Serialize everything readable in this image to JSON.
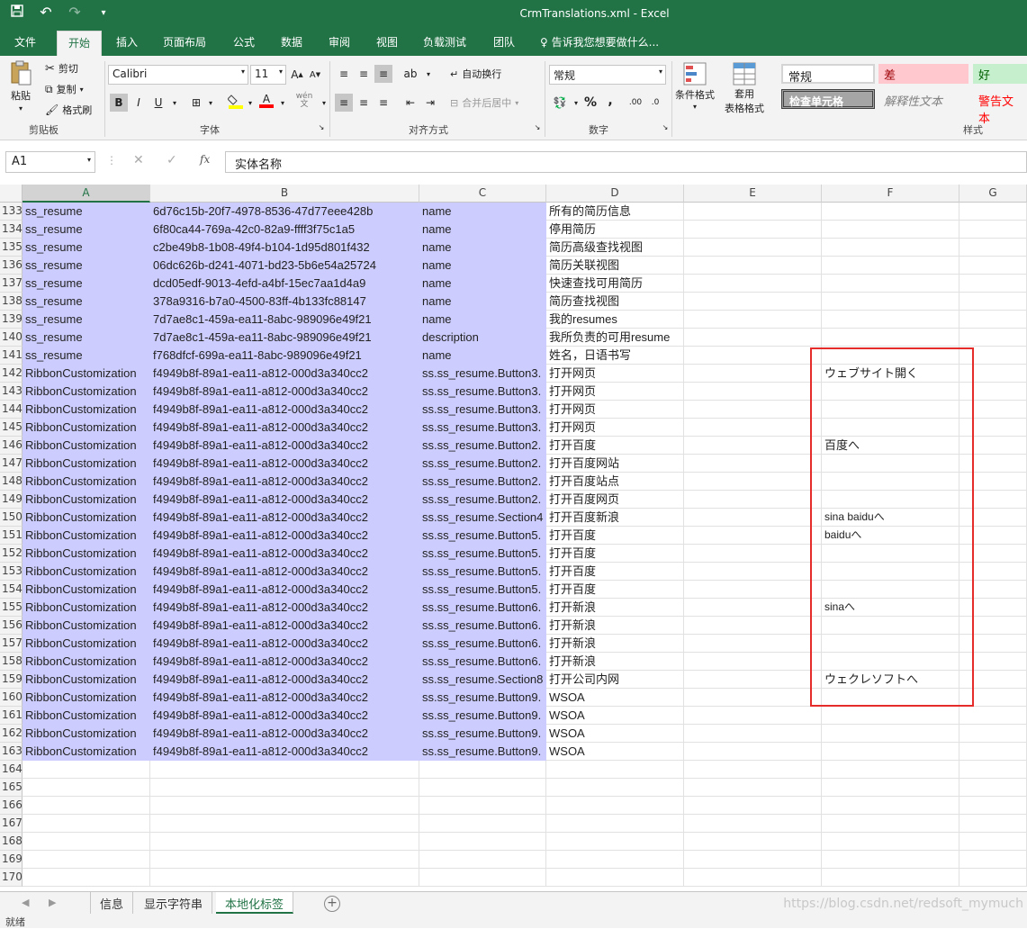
{
  "window": {
    "title": "CrmTranslations.xml - Excel"
  },
  "qat": {
    "save_icon": "save-icon",
    "undo_icon": "undo-icon",
    "redo_icon": "redo-icon"
  },
  "ribbon_tabs": [
    "文件",
    "开始",
    "插入",
    "页面布局",
    "公式",
    "数据",
    "审阅",
    "视图",
    "负载测试",
    "团队"
  ],
  "tell_me": "告诉我您想要做什么...",
  "clipboard": {
    "paste": "粘贴",
    "cut": "剪切",
    "copy": "复制",
    "format_painter": "格式刷",
    "label": "剪贴板"
  },
  "font": {
    "name": "Calibri",
    "size": "11",
    "bold": "B",
    "italic": "I",
    "underline": "U",
    "label": "字体",
    "wen": "wén",
    "wen_char": "文"
  },
  "alignment": {
    "wrap_text": "自动换行",
    "merge_center": "合并后居中",
    "label": "对齐方式"
  },
  "number": {
    "format": "常规",
    "percent": "%",
    "comma": ",",
    "label": "数字"
  },
  "styles": {
    "conditional_formatting": "条件格式",
    "format_as_table_1": "套用",
    "format_as_table_2": "表格格式",
    "normal": "常规",
    "bad": "差",
    "good": "好",
    "check_cell": "检查单元格",
    "explanatory": "解释性文本",
    "warning": "警告文本",
    "label": "样式"
  },
  "formula_bar": {
    "name_box": "A1",
    "content": "实体名称"
  },
  "columns": [
    "A",
    "B",
    "C",
    "D",
    "E",
    "F",
    "G"
  ],
  "rows": [
    {
      "n": "133",
      "a": "ss_resume",
      "b": "6d76c15b-20f7-4978-8536-47d77eee428b",
      "c": "name",
      "d": "所有的简历信息",
      "f": ""
    },
    {
      "n": "134",
      "a": "ss_resume",
      "b": "6f80ca44-769a-42c0-82a9-ffff3f75c1a5",
      "c": "name",
      "d": "停用简历",
      "f": ""
    },
    {
      "n": "135",
      "a": "ss_resume",
      "b": "c2be49b8-1b08-49f4-b104-1d95d801f432",
      "c": "name",
      "d": "简历高级查找视图",
      "f": ""
    },
    {
      "n": "136",
      "a": "ss_resume",
      "b": "06dc626b-d241-4071-bd23-5b6e54a25724",
      "c": "name",
      "d": "简历关联视图",
      "f": ""
    },
    {
      "n": "137",
      "a": "ss_resume",
      "b": "dcd05edf-9013-4efd-a4bf-15ec7aa1d4a9",
      "c": "name",
      "d": "快速查找可用简历",
      "f": ""
    },
    {
      "n": "138",
      "a": "ss_resume",
      "b": "378a9316-b7a0-4500-83ff-4b133fc88147",
      "c": "name",
      "d": "简历查找视图",
      "f": ""
    },
    {
      "n": "139",
      "a": "ss_resume",
      "b": "7d7ae8c1-459a-ea11-8abc-989096e49f21",
      "c": "name",
      "d": "我的resumes",
      "f": ""
    },
    {
      "n": "140",
      "a": "ss_resume",
      "b": "7d7ae8c1-459a-ea11-8abc-989096e49f21",
      "c": "description",
      "d": "我所负责的可用resume",
      "f": ""
    },
    {
      "n": "141",
      "a": "ss_resume",
      "b": "f768dfcf-699a-ea11-8abc-989096e49f21",
      "c": "name",
      "d": "姓名，日语书写",
      "f": ""
    },
    {
      "n": "142",
      "a": "RibbonCustomization",
      "b": "f4949b8f-89a1-ea11-a812-000d3a340cc2",
      "c": "ss.ss_resume.Button3.",
      "d": "打开网页",
      "f": "ウェブサイト開く"
    },
    {
      "n": "143",
      "a": "RibbonCustomization",
      "b": "f4949b8f-89a1-ea11-a812-000d3a340cc2",
      "c": "ss.ss_resume.Button3.",
      "d": "打开网页",
      "f": ""
    },
    {
      "n": "144",
      "a": "RibbonCustomization",
      "b": "f4949b8f-89a1-ea11-a812-000d3a340cc2",
      "c": "ss.ss_resume.Button3.",
      "d": "打开网页",
      "f": ""
    },
    {
      "n": "145",
      "a": "RibbonCustomization",
      "b": "f4949b8f-89a1-ea11-a812-000d3a340cc2",
      "c": "ss.ss_resume.Button3.",
      "d": "打开网页",
      "f": ""
    },
    {
      "n": "146",
      "a": "RibbonCustomization",
      "b": "f4949b8f-89a1-ea11-a812-000d3a340cc2",
      "c": "ss.ss_resume.Button2.",
      "d": "打开百度",
      "f": "百度へ"
    },
    {
      "n": "147",
      "a": "RibbonCustomization",
      "b": "f4949b8f-89a1-ea11-a812-000d3a340cc2",
      "c": "ss.ss_resume.Button2.",
      "d": "打开百度网站",
      "f": ""
    },
    {
      "n": "148",
      "a": "RibbonCustomization",
      "b": "f4949b8f-89a1-ea11-a812-000d3a340cc2",
      "c": "ss.ss_resume.Button2.",
      "d": "打开百度站点",
      "f": ""
    },
    {
      "n": "149",
      "a": "RibbonCustomization",
      "b": "f4949b8f-89a1-ea11-a812-000d3a340cc2",
      "c": "ss.ss_resume.Button2.",
      "d": "打开百度网页",
      "f": ""
    },
    {
      "n": "150",
      "a": "RibbonCustomization",
      "b": "f4949b8f-89a1-ea11-a812-000d3a340cc2",
      "c": "ss.ss_resume.Section4",
      "d": "打开百度新浪",
      "f": "sina baiduへ"
    },
    {
      "n": "151",
      "a": "RibbonCustomization",
      "b": "f4949b8f-89a1-ea11-a812-000d3a340cc2",
      "c": "ss.ss_resume.Button5.",
      "d": "打开百度",
      "f": "baiduへ"
    },
    {
      "n": "152",
      "a": "RibbonCustomization",
      "b": "f4949b8f-89a1-ea11-a812-000d3a340cc2",
      "c": "ss.ss_resume.Button5.",
      "d": "打开百度",
      "f": ""
    },
    {
      "n": "153",
      "a": "RibbonCustomization",
      "b": "f4949b8f-89a1-ea11-a812-000d3a340cc2",
      "c": "ss.ss_resume.Button5.",
      "d": "打开百度",
      "f": ""
    },
    {
      "n": "154",
      "a": "RibbonCustomization",
      "b": "f4949b8f-89a1-ea11-a812-000d3a340cc2",
      "c": "ss.ss_resume.Button5.",
      "d": "打开百度",
      "f": ""
    },
    {
      "n": "155",
      "a": "RibbonCustomization",
      "b": "f4949b8f-89a1-ea11-a812-000d3a340cc2",
      "c": "ss.ss_resume.Button6.",
      "d": "打开新浪",
      "f": "sinaへ"
    },
    {
      "n": "156",
      "a": "RibbonCustomization",
      "b": "f4949b8f-89a1-ea11-a812-000d3a340cc2",
      "c": "ss.ss_resume.Button6.",
      "d": "打开新浪",
      "f": ""
    },
    {
      "n": "157",
      "a": "RibbonCustomization",
      "b": "f4949b8f-89a1-ea11-a812-000d3a340cc2",
      "c": "ss.ss_resume.Button6.",
      "d": "打开新浪",
      "f": ""
    },
    {
      "n": "158",
      "a": "RibbonCustomization",
      "b": "f4949b8f-89a1-ea11-a812-000d3a340cc2",
      "c": "ss.ss_resume.Button6.",
      "d": "打开新浪",
      "f": ""
    },
    {
      "n": "159",
      "a": "RibbonCustomization",
      "b": "f4949b8f-89a1-ea11-a812-000d3a340cc2",
      "c": "ss.ss_resume.Section8",
      "d": "打开公司内网",
      "f": "ウェクレソフトへ"
    },
    {
      "n": "160",
      "a": "RibbonCustomization",
      "b": "f4949b8f-89a1-ea11-a812-000d3a340cc2",
      "c": "ss.ss_resume.Button9.",
      "d": "WSOA",
      "f": ""
    },
    {
      "n": "161",
      "a": "RibbonCustomization",
      "b": "f4949b8f-89a1-ea11-a812-000d3a340cc2",
      "c": "ss.ss_resume.Button9.",
      "d": "WSOA",
      "f": ""
    },
    {
      "n": "162",
      "a": "RibbonCustomization",
      "b": "f4949b8f-89a1-ea11-a812-000d3a340cc2",
      "c": "ss.ss_resume.Button9.",
      "d": "WSOA",
      "f": ""
    },
    {
      "n": "163",
      "a": "RibbonCustomization",
      "b": "f4949b8f-89a1-ea11-a812-000d3a340cc2",
      "c": "ss.ss_resume.Button9.",
      "d": "WSOA",
      "f": ""
    },
    {
      "n": "164",
      "a": "",
      "b": "",
      "c": "",
      "d": "",
      "f": ""
    },
    {
      "n": "165",
      "a": "",
      "b": "",
      "c": "",
      "d": "",
      "f": ""
    },
    {
      "n": "166",
      "a": "",
      "b": "",
      "c": "",
      "d": "",
      "f": ""
    },
    {
      "n": "167",
      "a": "",
      "b": "",
      "c": "",
      "d": "",
      "f": ""
    },
    {
      "n": "168",
      "a": "",
      "b": "",
      "c": "",
      "d": "",
      "f": ""
    },
    {
      "n": "169",
      "a": "",
      "b": "",
      "c": "",
      "d": "",
      "f": ""
    },
    {
      "n": "170",
      "a": "",
      "b": "",
      "c": "",
      "d": "",
      "f": ""
    }
  ],
  "sheet_tabs": [
    "信息",
    "显示字符串",
    "本地化标签"
  ],
  "active_sheet": "本地化标签",
  "watermark": "https://blog.csdn.net/redsoft_mymuch",
  "status": "就绪",
  "colors": {
    "excel_green": "#217346",
    "highlight": "#ccccff",
    "annotation_red": "#e62b2b"
  }
}
